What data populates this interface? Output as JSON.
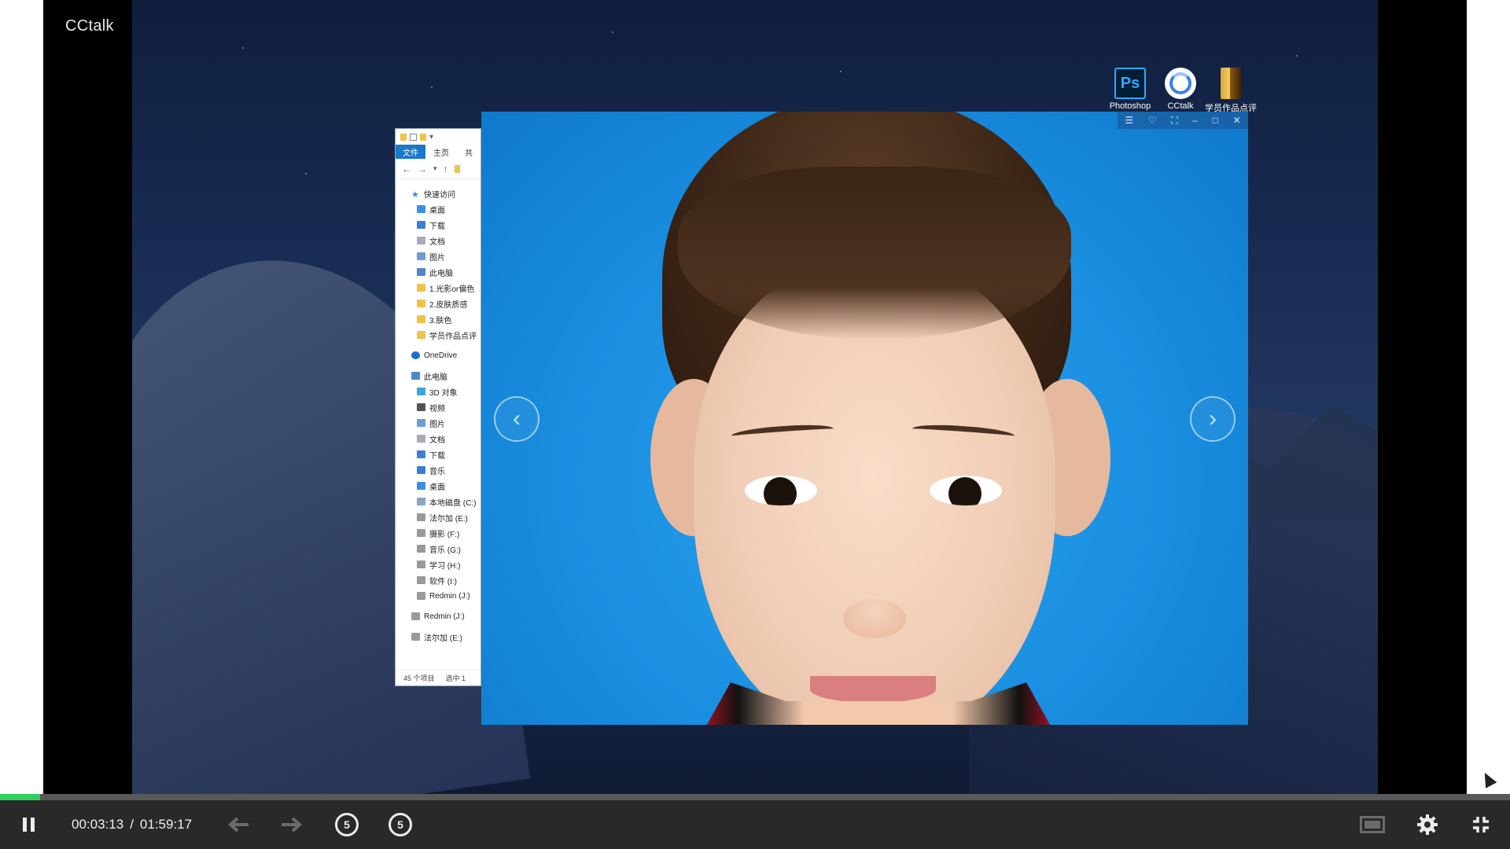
{
  "app": {
    "brand": "CCtalk"
  },
  "desktop_icons": [
    {
      "label": "Photoshop",
      "glyph_text": "Ps",
      "icon": "photoshop-icon"
    },
    {
      "label": "CCtalk",
      "icon": "cctalk-icon"
    },
    {
      "label": "学员作品点评",
      "icon": "folder-icon"
    }
  ],
  "explorer": {
    "ribbon_tabs": {
      "file": "文件",
      "home": "主页",
      "share": "共"
    },
    "quick_access_header": "快速访问",
    "quick_access": [
      "桌面",
      "下载",
      "文档",
      "图片",
      "此电脑",
      "1.光影or偏色",
      "2.皮肤质感",
      "3.肤色",
      "学员作品点评"
    ],
    "onedrive": "OneDrive",
    "this_pc_header": "此电脑",
    "this_pc": [
      "3D 对象",
      "视频",
      "图片",
      "文档",
      "下载",
      "音乐",
      "桌面",
      "本地磁盘 (C:)",
      "法尔加 (E:)",
      "摄影 (F:)",
      "音乐 (G:)",
      "学习 (H:)",
      "软件 (I:)",
      "Redmin (J:)"
    ],
    "drives_extra": [
      "Redmin (J:)",
      "法尔加 (E:)"
    ],
    "status_items": "45 个项目",
    "status_selected": "选中 1"
  },
  "viewer": {
    "prev_glyph": "‹",
    "next_glyph": "›",
    "window_buttons": [
      "☰",
      "♡",
      "⛶",
      "–",
      "□",
      "✕"
    ]
  },
  "player": {
    "progress": 0.0268,
    "current_time": "00:03:13",
    "separator": "/",
    "total_time": "01:59:17",
    "skip_back_label": "5",
    "skip_forward_label": "5",
    "colors": {
      "progress_fill": "#2fd05a",
      "bar_bg": "#292929"
    }
  }
}
